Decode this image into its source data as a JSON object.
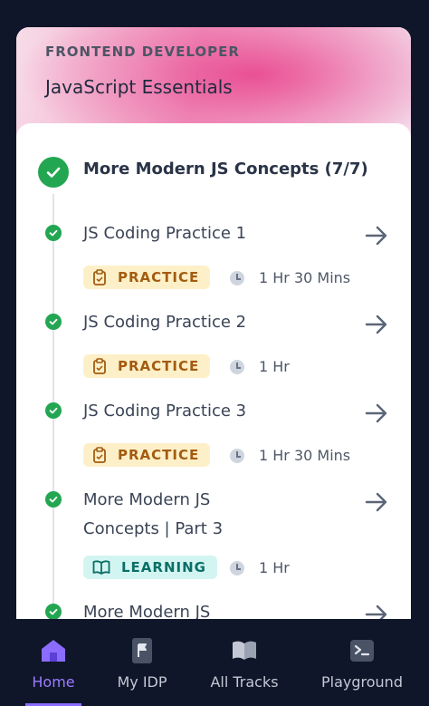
{
  "course": {
    "track_label": "FRONTEND DEVELOPER",
    "title": "JavaScript Essentials"
  },
  "section": {
    "title": "More Modern JS Concepts (7/7)"
  },
  "items": [
    {
      "title": "JS Coding Practice 1",
      "badge": "PRACTICE",
      "duration": "1 Hr 30 Mins"
    },
    {
      "title": "JS Coding Practice 2",
      "badge": "PRACTICE",
      "duration": "1 Hr"
    },
    {
      "title": "JS Coding Practice 3",
      "badge": "PRACTICE",
      "duration": "1 Hr 30 Mins"
    },
    {
      "title_line1": "More Modern JS",
      "title_line2": "Concepts | Part 3",
      "badge": "LEARNING",
      "duration": "1 Hr"
    },
    {
      "title_line1": "More Modern JS"
    }
  ],
  "nav": {
    "home": "Home",
    "my_idp": "My IDP",
    "all_tracks": "All Tracks",
    "playground": "Playground"
  },
  "colors": {
    "success": "#23a652",
    "practice_bg": "#fdf0c8",
    "learning_bg": "#d3f5f1",
    "nav_active": "#8b6cff"
  }
}
